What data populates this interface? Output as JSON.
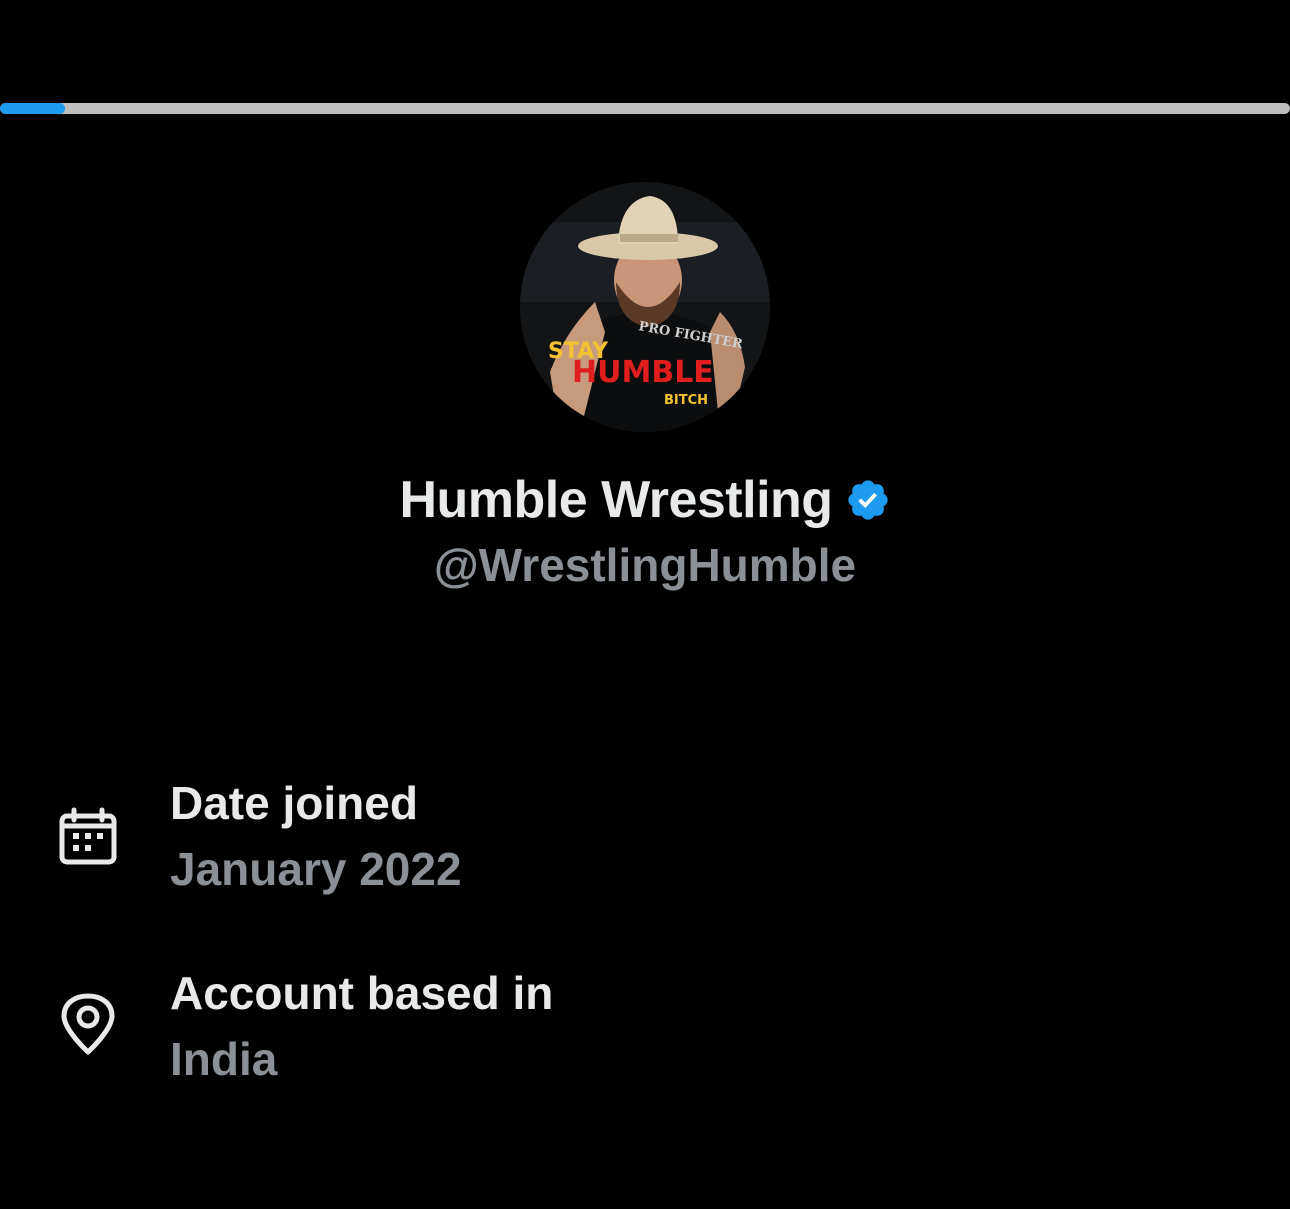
{
  "progress": {
    "value_fraction": 0.05,
    "accent_color": "#1d9bf0"
  },
  "avatar": {
    "description_icon": "profile-photo",
    "overlay_text": [
      "STAY",
      "HUMBLE",
      "BITCH"
    ],
    "shirt_text": "PRO FIGHTER"
  },
  "profile": {
    "display_name": "Humble Wrestling",
    "verified": true,
    "handle": "@WrestlingHumble"
  },
  "about": [
    {
      "icon": "calendar-icon",
      "label": "Date joined",
      "value": "January 2022"
    },
    {
      "icon": "location-pin-icon",
      "label": "Account based in",
      "value": "India"
    }
  ],
  "colors": {
    "background": "#000000",
    "primary_text": "#e7e9ea",
    "secondary_text": "#8b9096",
    "verified": "#1d9bf0"
  }
}
